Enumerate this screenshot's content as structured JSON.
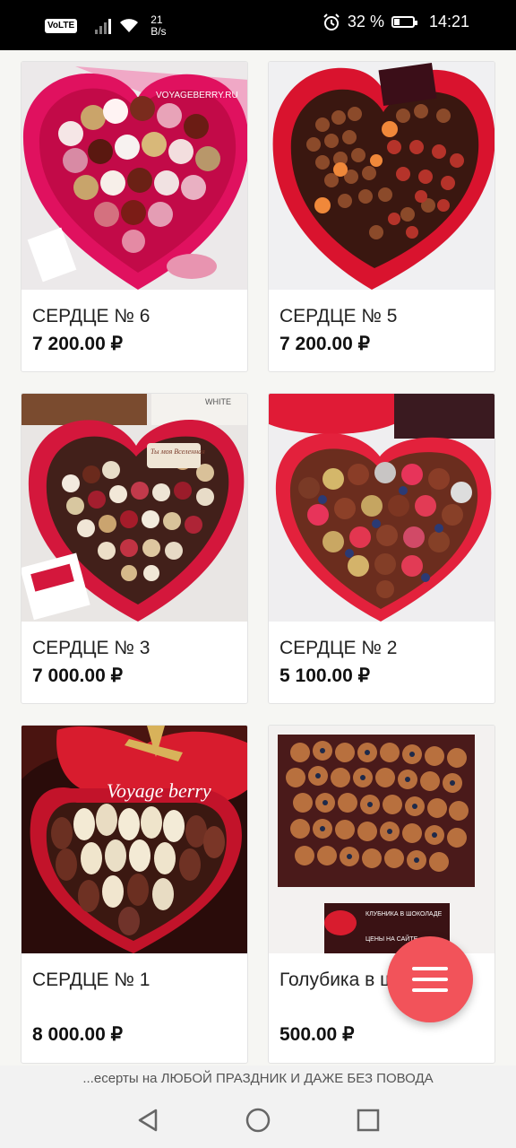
{
  "status_bar": {
    "volte": "VoLTE",
    "speed_value": "21",
    "speed_unit": "B/s",
    "battery_percent": "32 %",
    "battery_level": 0.32,
    "time": "14:21"
  },
  "products": [
    {
      "title": "СЕРДЦЕ № 6",
      "price": "7 200.00 ₽",
      "watermark": "VOYAGEBERRY.RU"
    },
    {
      "title": "СЕРДЦЕ № 5",
      "price": "7 200.00 ₽"
    },
    {
      "title": "СЕРДЦЕ № 3",
      "price": "7 000.00 ₽",
      "box_label": "WHITE",
      "heart_text": "Ты моя Вселенная"
    },
    {
      "title": "СЕРДЦЕ № 2",
      "price": "5 100.00 ₽"
    },
    {
      "title": "СЕРДЦЕ № 1",
      "price": "8 000.00 ₽",
      "watermark": "Voyage berry"
    },
    {
      "title": "Голубика в шоколаде",
      "price": "500.00 ₽",
      "card_text": "КЛУБНИКА В ШОКОЛАДЕ",
      "card_subtext": "ЦЕНЫ НА САЙТЕ"
    }
  ],
  "menu_button": {
    "icon": "hamburger-icon",
    "color": "#f2535a"
  },
  "marquee_text": "...есерты на ЛЮБОЙ ПРАЗДНИК И ДАЖЕ БЕЗ ПОВОДА",
  "navigation": {
    "back": "back-icon",
    "home": "home-icon",
    "recents": "recents-icon"
  }
}
